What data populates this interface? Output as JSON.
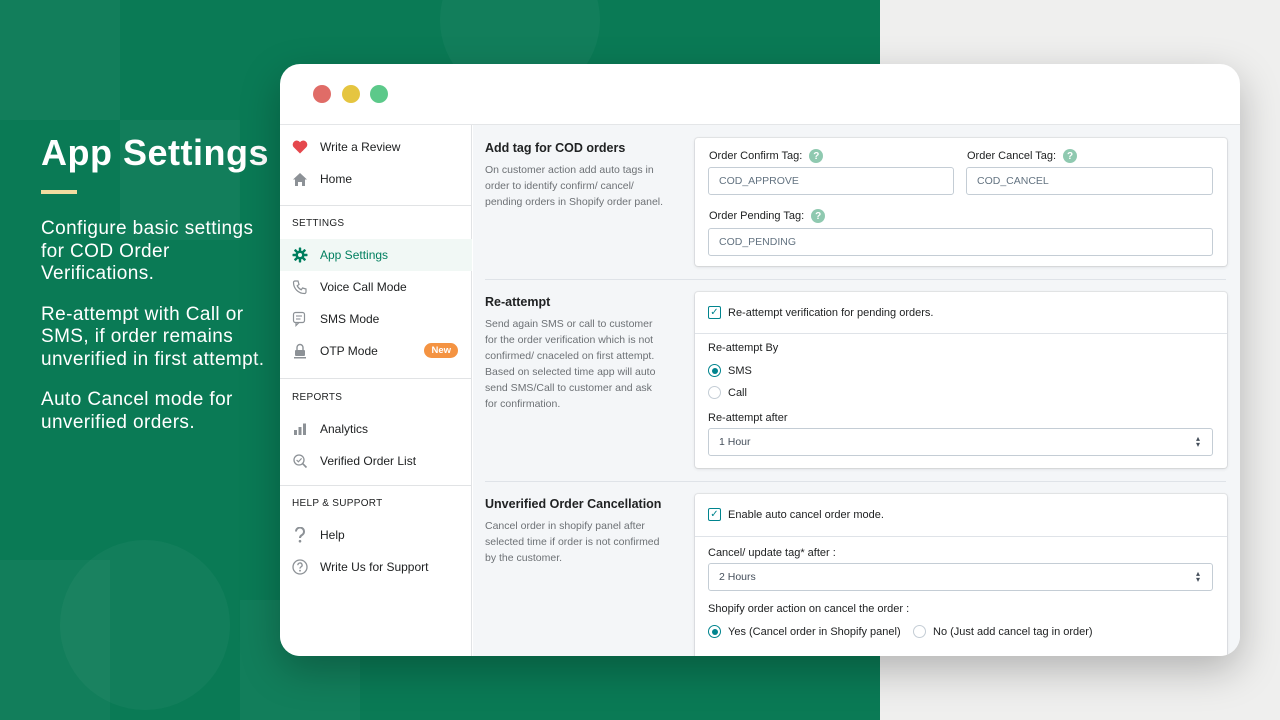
{
  "colors": {
    "brand_green": "#0a7a55",
    "accent": "#007f5f",
    "badge_orange": "#f49342",
    "highlight_bar": "#f2dca0"
  },
  "promo": {
    "title": "App Settings",
    "lines": [
      "Configure basic settings for COD Order Verifications.",
      "Re-attempt with Call or SMS, if order remains unverified in first attempt.",
      "Auto Cancel mode for unverified orders."
    ]
  },
  "window": {
    "dots": [
      {
        "name": "close",
        "color": "#e06c67"
      },
      {
        "name": "minimize",
        "color": "#e5c540"
      },
      {
        "name": "maximize",
        "color": "#5cc98a"
      }
    ]
  },
  "sidebar": {
    "top_items": [
      {
        "label": "Write a Review",
        "icon": "heart-icon"
      },
      {
        "label": "Home",
        "icon": "home-icon"
      }
    ],
    "settings_header": "SETTINGS",
    "settings_items": [
      {
        "label": "App Settings",
        "icon": "gear-icon",
        "active": true
      },
      {
        "label": "Voice Call Mode",
        "icon": "phone-icon"
      },
      {
        "label": "SMS Mode",
        "icon": "sms-icon"
      },
      {
        "label": "OTP Mode",
        "icon": "lock-icon",
        "badge": "New"
      }
    ],
    "reports_header": "REPORTS",
    "reports_items": [
      {
        "label": "Analytics",
        "icon": "bar-chart-icon"
      },
      {
        "label": "Verified Order List",
        "icon": "verified-search-icon"
      }
    ],
    "support_header": "HELP & SUPPORT",
    "support_items": [
      {
        "label": "Help",
        "icon": "question-icon"
      },
      {
        "label": "Write Us for Support",
        "icon": "question-circle-icon"
      }
    ]
  },
  "sections": {
    "tags": {
      "title": "Add tag for COD orders",
      "description": "On customer action add auto tags in order to identify confirm/ cancel/ pending orders in Shopify order panel.",
      "confirm_label": "Order Confirm Tag:",
      "confirm_value": "COD_APPROVE",
      "cancel_label": "Order Cancel Tag:",
      "cancel_value": "COD_CANCEL",
      "pending_label": "Order Pending Tag:",
      "pending_value": "COD_PENDING",
      "help_glyph": "?"
    },
    "reattempt": {
      "title": "Re-attempt",
      "description": "Send again SMS or call to customer for the order verification which is not confirmed/ cnaceled on first attempt.",
      "description2": "Based on selected time app will auto send SMS/Call to customer and ask for confirmation.",
      "checkbox_label": "Re-attempt verification for pending orders.",
      "checked": true,
      "by_label": "Re-attempt By",
      "options": [
        {
          "label": "SMS",
          "selected": true
        },
        {
          "label": "Call",
          "selected": false
        }
      ],
      "after_label": "Re-attempt after",
      "after_value": "1 Hour"
    },
    "cancellation": {
      "title": "Unverified Order Cancellation",
      "description": "Cancel order in shopify panel after selected time if order is not confirmed by the customer.",
      "checkbox_label": "Enable auto cancel order mode.",
      "checked": true,
      "after_label": "Cancel/ update tag* after :",
      "after_value": "2 Hours",
      "action_label": "Shopify order action on cancel the order :",
      "options": [
        {
          "label": "Yes (Cancel order in Shopify panel)",
          "selected": true
        },
        {
          "label": "No (Just add cancel tag in order)",
          "selected": false
        }
      ]
    }
  }
}
